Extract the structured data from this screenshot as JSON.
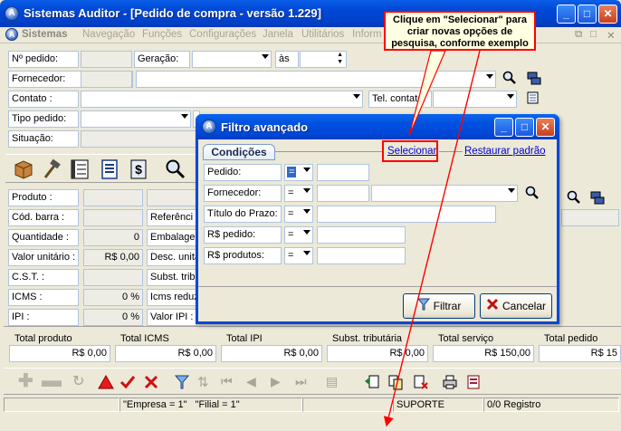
{
  "window": {
    "title": "Sistemas Auditor - [Pedido de compra - versão 1.229]"
  },
  "menu": {
    "app_label": "Sistemas",
    "items": [
      "Navegação",
      "Funções",
      "Configurações",
      "Janela",
      "Utilitários",
      "Inform"
    ]
  },
  "callout": {
    "line1": "Clique em \"Selecionar\" para",
    "line2": "criar novas opções de",
    "line3": "pesquisa, conforme exemplo"
  },
  "header_form": {
    "pedido_label": "Nº pedido:",
    "geracao_label": "Geração:",
    "as_label": "às",
    "fornecedor_label": "Fornecedor:",
    "contato_label": "Contato :",
    "tel_contato_label": "Tel. contato:",
    "tipo_pedido_label": "Tipo pedido:",
    "situacao_label": "Situação:"
  },
  "item_form": {
    "produto_label": "Produto :",
    "cod_barra_label": "Cód. barra :",
    "quantidade_label": "Quantidade :",
    "quantidade_value": "0",
    "valor_unitario_label": "Valor unitário :",
    "valor_unitario_value": "R$ 0,00",
    "cst_label": "C.S.T. :",
    "icms_label": "ICMS :",
    "icms_value": "0 %",
    "ipi_label": "IPI :",
    "ipi_value": "0 %",
    "referencia_label": "Referênci",
    "embalagem_label": "Embalagen",
    "desc_unit_label": "Desc. unitá",
    "subst_trib_label": "Subst. tribu",
    "icms_reduz_label": "Icms reduz",
    "valor_ipi_label": "Valor IPI :"
  },
  "totals": [
    {
      "label": "Total produto",
      "value": "R$ 0,00"
    },
    {
      "label": "Total ICMS",
      "value": "R$ 0,00"
    },
    {
      "label": "Total IPI",
      "value": "R$ 0,00"
    },
    {
      "label": "Subst. tributária",
      "value": "R$ 0,00"
    },
    {
      "label": "Total serviço",
      "value": "R$ 150,00"
    },
    {
      "label": "Total pedido",
      "value": "R$ 15"
    }
  ],
  "status": {
    "empresa": "\"Empresa = 1\"",
    "filial": "\"Filial = 1\"",
    "user": "SUPORTE",
    "registro": "0/0 Registro"
  },
  "dialog": {
    "title": "Filtro avançado",
    "tab_label": "Condições",
    "selecionar_link": "Selecionar",
    "restaurar_link": "Restaurar padrão",
    "rows": [
      {
        "label": "Pedido:",
        "operator": "="
      },
      {
        "label": "Fornecedor:",
        "operator": "="
      },
      {
        "label": "Título do Prazo:",
        "operator": "="
      },
      {
        "label": "R$ pedido:",
        "operator": "="
      },
      {
        "label": "R$ produtos:",
        "operator": "="
      }
    ],
    "filtrar_label": "Filtrar",
    "cancelar_label": "Cancelar"
  },
  "colors": {
    "title_blue": "#0046d5",
    "highlight_red": "#ff0000",
    "callout_bg": "#ffffe1"
  }
}
